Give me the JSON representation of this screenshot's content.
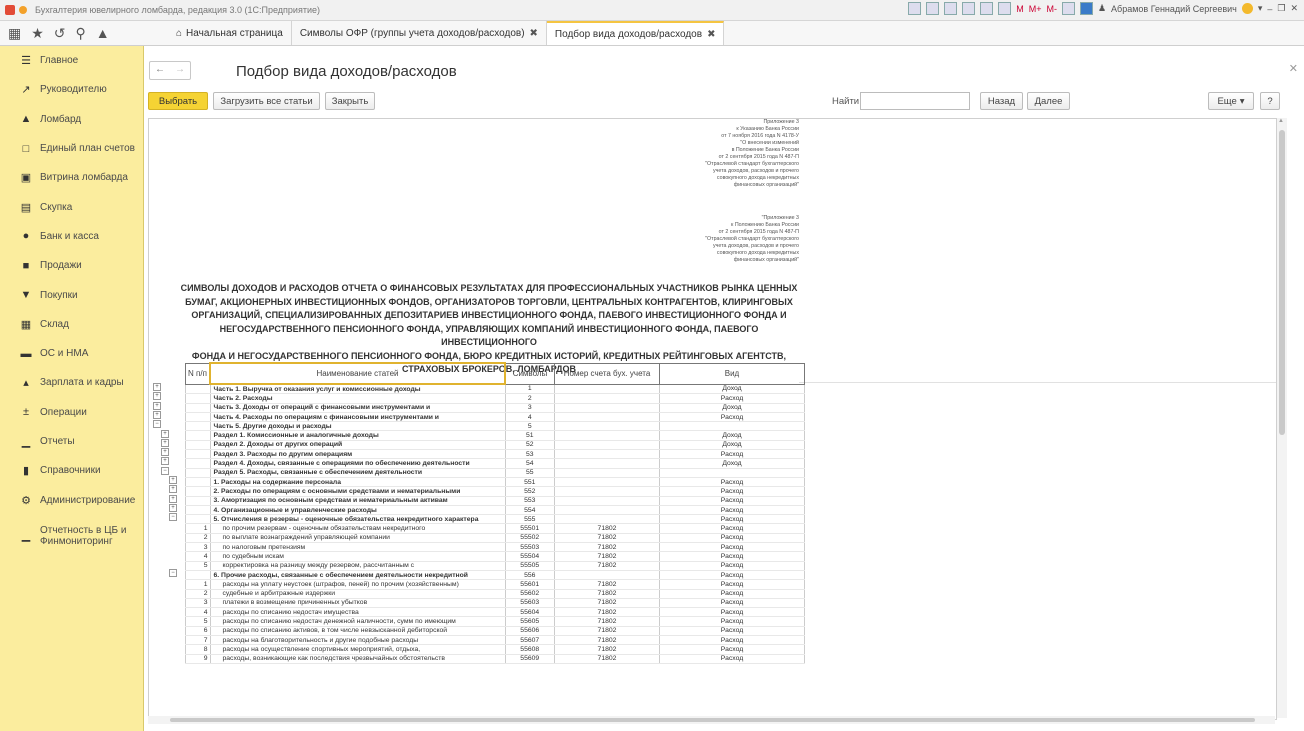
{
  "window": {
    "title": "Бухгалтерия ювелирного ломбарда, редакция 3.0 (1С:Предприятие)",
    "user": "Абрамов Геннадий Сергеевич"
  },
  "tabs": [
    {
      "label": "Начальная страница"
    },
    {
      "label": "Символы ОФР (группы учета доходов/расходов)"
    },
    {
      "label": "Подбор вида доходов/расходов"
    }
  ],
  "sidebar": {
    "items": [
      {
        "label": "Главное",
        "icon": "menu-icon"
      },
      {
        "label": "Руководителю",
        "icon": "chart-line-icon"
      },
      {
        "label": "Ломбард",
        "icon": "bag-icon"
      },
      {
        "label": "Единый план счетов",
        "icon": "book-icon"
      },
      {
        "label": "Витрина ломбарда",
        "icon": "showcase-icon"
      },
      {
        "label": "Скупка",
        "icon": "buildings-icon"
      },
      {
        "label": "Банк и касса",
        "icon": "coin-icon"
      },
      {
        "label": "Продажи",
        "icon": "shop-icon"
      },
      {
        "label": "Покупки",
        "icon": "cart-icon"
      },
      {
        "label": "Склад",
        "icon": "warehouse-icon"
      },
      {
        "label": "ОС и НМА",
        "icon": "truck-icon"
      },
      {
        "label": "Зарплата и кадры",
        "icon": "person-icon"
      },
      {
        "label": "Операции",
        "icon": "operations-icon"
      },
      {
        "label": "Отчеты",
        "icon": "bar-chart-icon"
      },
      {
        "label": "Справочники",
        "icon": "directory-icon"
      },
      {
        "label": "Администрирование",
        "icon": "gear-icon"
      },
      {
        "label": "Отчетность в ЦБ и Финмониторинг",
        "icon": "bar-chart-icon"
      }
    ]
  },
  "form": {
    "title": "Подбор вида доходов/расходов",
    "buttons": {
      "select": "Выбрать",
      "load_all": "Загрузить все статьи",
      "close": "Закрыть",
      "back": "Назад",
      "next": "Далее",
      "more": "Еще",
      "help": "?"
    },
    "find_label": "Найти:",
    "find_value": ""
  },
  "report": {
    "appendix1": [
      "Приложение 3",
      "к Указанию Банка России",
      "от 7 ноября 2016 года N 4178-У",
      "\"О внесении изменений",
      "в Положение Банка России",
      "от 2 сентября 2015 года N 487-П",
      "\"Отраслевой стандарт бухгалтерского",
      "учета доходов, расходов и прочего",
      "совокупного дохода некредитных",
      "финансовых организаций\""
    ],
    "appendix2": [
      "\"Приложение 3",
      "к Положению Банка России",
      "от 2 сентября 2015 года N 487-П",
      "\"Отраслевой стандарт бухгалтерского",
      "учета доходов, расходов и прочего",
      "совокупного дохода некредитных",
      "финансовых организаций\""
    ],
    "title_lines": [
      "СИМВОЛЫ ДОХОДОВ И РАСХОДОВ ОТЧЕТА О ФИНАНСОВЫХ РЕЗУЛЬТАТАХ ДЛЯ ПРОФЕССИОНАЛЬНЫХ УЧАСТНИКОВ РЫНКА ЦЕННЫХ",
      "БУМАГ, АКЦИОНЕРНЫХ ИНВЕСТИЦИОННЫХ ФОНДОВ, ОРГАНИЗАТОРОВ ТОРГОВЛИ, ЦЕНТРАЛЬНЫХ КОНТРАГЕНТОВ, КЛИРИНГОВЫХ",
      "ОРГАНИЗАЦИЙ, СПЕЦИАЛИЗИРОВАННЫХ ДЕПОЗИТАРИЕВ ИНВЕСТИЦИОННОГО ФОНДА, ПАЕВОГО ИНВЕСТИЦИОННОГО ФОНДА И",
      "НЕГОСУДАРСТВЕННОГО ПЕНСИОННОГО ФОНДА, УПРАВЛЯЮЩИХ КОМПАНИЙ ИНВЕСТИЦИОННОГО ФОНДА, ПАЕВОГО ИНВЕСТИЦИОННОГО",
      "ФОНДА И НЕГОСУДАРСТВЕННОГО ПЕНСИОННОГО ФОНДА, БЮРО КРЕДИТНЫХ ИСТОРИЙ, КРЕДИТНЫХ РЕЙТИНГОВЫХ АГЕНТСТВ,",
      "СТРАХОВЫХ БРОКЕРОВ, ЛОМБАРДОВ"
    ],
    "columns": [
      "N п/п",
      "Наименование статей",
      "Символы",
      "Номер счета бух. учета",
      "Вид"
    ],
    "rows": [
      {
        "n": "",
        "name": "Часть 1. Выручка от оказания услуг и комиссионные доходы",
        "sym": "1",
        "acc": "",
        "kind": "Доход",
        "bold": true,
        "lvl": 0,
        "pm": "+"
      },
      {
        "n": "",
        "name": "Часть 2. Расходы",
        "sym": "2",
        "acc": "",
        "kind": "Расход",
        "bold": true,
        "lvl": 0,
        "pm": "+"
      },
      {
        "n": "",
        "name": "Часть 3. Доходы от операций с финансовыми инструментами и",
        "sym": "3",
        "acc": "",
        "kind": "Доход",
        "bold": true,
        "lvl": 0,
        "pm": "+"
      },
      {
        "n": "",
        "name": "Часть 4. Расходы по операциям с финансовыми инструментами и",
        "sym": "4",
        "acc": "",
        "kind": "Расход",
        "bold": true,
        "lvl": 0,
        "pm": "+"
      },
      {
        "n": "",
        "name": "Часть 5. Другие доходы и расходы",
        "sym": "5",
        "acc": "",
        "kind": "",
        "bold": true,
        "lvl": 0,
        "pm": "-"
      },
      {
        "n": "",
        "name": "Раздел 1. Комиссионные и аналогичные доходы",
        "sym": "51",
        "acc": "",
        "kind": "Доход",
        "bold": true,
        "lvl": 1,
        "pm": "+"
      },
      {
        "n": "",
        "name": "Раздел 2. Доходы от других операций",
        "sym": "52",
        "acc": "",
        "kind": "Доход",
        "bold": true,
        "lvl": 1,
        "pm": "+"
      },
      {
        "n": "",
        "name": "Раздел 3. Расходы по другим операциям",
        "sym": "53",
        "acc": "",
        "kind": "Расход",
        "bold": true,
        "lvl": 1,
        "pm": "+"
      },
      {
        "n": "",
        "name": "Раздел 4. Доходы, связанные с операциями по обеспечению деятельности",
        "sym": "54",
        "acc": "",
        "kind": "Доход",
        "bold": true,
        "lvl": 1,
        "pm": "+"
      },
      {
        "n": "",
        "name": "Раздел 5. Расходы, связанные с обеспечением деятельности",
        "sym": "55",
        "acc": "",
        "kind": "",
        "bold": true,
        "lvl": 1,
        "pm": "-"
      },
      {
        "n": "",
        "name": "1. Расходы на содержание персонала",
        "sym": "551",
        "acc": "",
        "kind": "Расход",
        "bold": true,
        "lvl": 2,
        "pm": "+"
      },
      {
        "n": "",
        "name": "2. Расходы по операциям с основными средствами и нематериальными",
        "sym": "552",
        "acc": "",
        "kind": "Расход",
        "bold": true,
        "lvl": 2,
        "pm": "+"
      },
      {
        "n": "",
        "name": "3. Амортизация по основным средствам и нематериальным активам",
        "sym": "553",
        "acc": "",
        "kind": "Расход",
        "bold": true,
        "lvl": 2,
        "pm": "+"
      },
      {
        "n": "",
        "name": "4. Организационные и управленческие расходы",
        "sym": "554",
        "acc": "",
        "kind": "Расход",
        "bold": true,
        "lvl": 2,
        "pm": "+"
      },
      {
        "n": "",
        "name": "5. Отчисления в резервы - оценочные обязательства некредитного характера",
        "sym": "555",
        "acc": "",
        "kind": "Расход",
        "bold": true,
        "lvl": 2,
        "pm": "-"
      },
      {
        "n": "1",
        "name": "по прочим резервам - оценочным обязательствам некредитного",
        "sym": "55501",
        "acc": "71802",
        "kind": "Расход",
        "bold": false,
        "lvl": 3,
        "pm": ""
      },
      {
        "n": "2",
        "name": "по выплате вознаграждений управляющей компании",
        "sym": "55502",
        "acc": "71802",
        "kind": "Расход",
        "bold": false,
        "lvl": 3,
        "pm": ""
      },
      {
        "n": "3",
        "name": "по налоговым претензиям",
        "sym": "55503",
        "acc": "71802",
        "kind": "Расход",
        "bold": false,
        "lvl": 3,
        "pm": ""
      },
      {
        "n": "4",
        "name": "по судебным искам",
        "sym": "55504",
        "acc": "71802",
        "kind": "Расход",
        "bold": false,
        "lvl": 3,
        "pm": ""
      },
      {
        "n": "5",
        "name": "корректировка на разницу между резервом, рассчитанным с",
        "sym": "55505",
        "acc": "71802",
        "kind": "Расход",
        "bold": false,
        "lvl": 3,
        "pm": ""
      },
      {
        "n": "",
        "name": "6. Прочие расходы, связанные с обеспечением деятельности некредитной",
        "sym": "556",
        "acc": "",
        "kind": "Расход",
        "bold": true,
        "lvl": 2,
        "pm": "-"
      },
      {
        "n": "1",
        "name": "расходы на уплату неустоек (штрафов, пеней) по прочим (хозяйственным)",
        "sym": "55601",
        "acc": "71802",
        "kind": "Расход",
        "bold": false,
        "lvl": 3,
        "pm": ""
      },
      {
        "n": "2",
        "name": "судебные и арбитражные издержки",
        "sym": "55602",
        "acc": "71802",
        "kind": "Расход",
        "bold": false,
        "lvl": 3,
        "pm": ""
      },
      {
        "n": "3",
        "name": "платежи в возмещение причиненных убытков",
        "sym": "55603",
        "acc": "71802",
        "kind": "Расход",
        "bold": false,
        "lvl": 3,
        "pm": ""
      },
      {
        "n": "4",
        "name": "расходы по списанию недостач имущества",
        "sym": "55604",
        "acc": "71802",
        "kind": "Расход",
        "bold": false,
        "lvl": 3,
        "pm": ""
      },
      {
        "n": "5",
        "name": "расходы по списанию недостач денежной наличности, сумм по имеющим",
        "sym": "55605",
        "acc": "71802",
        "kind": "Расход",
        "bold": false,
        "lvl": 3,
        "pm": ""
      },
      {
        "n": "6",
        "name": "расходы по списанию активов, в том числе невзысканной дебиторской",
        "sym": "55606",
        "acc": "71802",
        "kind": "Расход",
        "bold": false,
        "lvl": 3,
        "pm": ""
      },
      {
        "n": "7",
        "name": "расходы на благотворительность и другие подобные расходы",
        "sym": "55607",
        "acc": "71802",
        "kind": "Расход",
        "bold": false,
        "lvl": 3,
        "pm": ""
      },
      {
        "n": "8",
        "name": "расходы на осуществление спортивных мероприятий, отдыха,",
        "sym": "55608",
        "acc": "71802",
        "kind": "Расход",
        "bold": false,
        "lvl": 3,
        "pm": ""
      },
      {
        "n": "9",
        "name": "расходы, возникающие как последствия чрезвычайных обстоятельств",
        "sym": "55609",
        "acc": "71802",
        "kind": "Расход",
        "bold": false,
        "lvl": 3,
        "pm": ""
      }
    ]
  }
}
